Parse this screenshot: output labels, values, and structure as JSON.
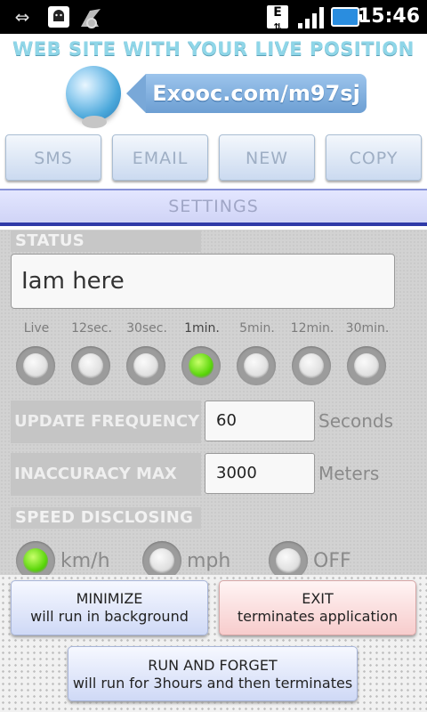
{
  "statusbar": {
    "time": "15:46",
    "icons": [
      "usb-icon",
      "android-debug-icon",
      "app-notification-icon",
      "edge-data-icon",
      "signal-icon",
      "battery-charging-icon"
    ]
  },
  "header": {
    "title": "WEB SITE WITH YOUR LIVE POSITION",
    "url": "Exooc.com/m97sj",
    "colors": {
      "title": "#8fd6e8",
      "url_tag": "#79a8d8"
    }
  },
  "actions": {
    "sms": "SMS",
    "email": "EMAIL",
    "new": "NEW",
    "copy": "COPY"
  },
  "settings_tab": "SETTINGS",
  "status": {
    "label": "STATUS",
    "value": "Iam here"
  },
  "frequency": {
    "options": [
      "Live",
      "12sec.",
      "30sec.",
      "1min.",
      "5min.",
      "12min.",
      "30min."
    ],
    "selected": "1min."
  },
  "update_frequency": {
    "label": "UPDATE FREQUENCY",
    "value": "60",
    "unit": "Seconds"
  },
  "inaccuracy": {
    "label": "INACCURACY MAX",
    "value": "3000",
    "unit": "Meters"
  },
  "speed": {
    "label": "SPEED DISCLOSING",
    "options": [
      "km/h",
      "mph",
      "OFF"
    ],
    "selected": "km/h"
  },
  "bottom": {
    "minimize": {
      "title": "MINIMIZE",
      "subtitle": "will run in background"
    },
    "exit": {
      "title": "EXIT",
      "subtitle": "terminates application"
    },
    "run": {
      "title": "RUN AND FORGET",
      "subtitle": "will run for 3hours and then terminates"
    }
  }
}
